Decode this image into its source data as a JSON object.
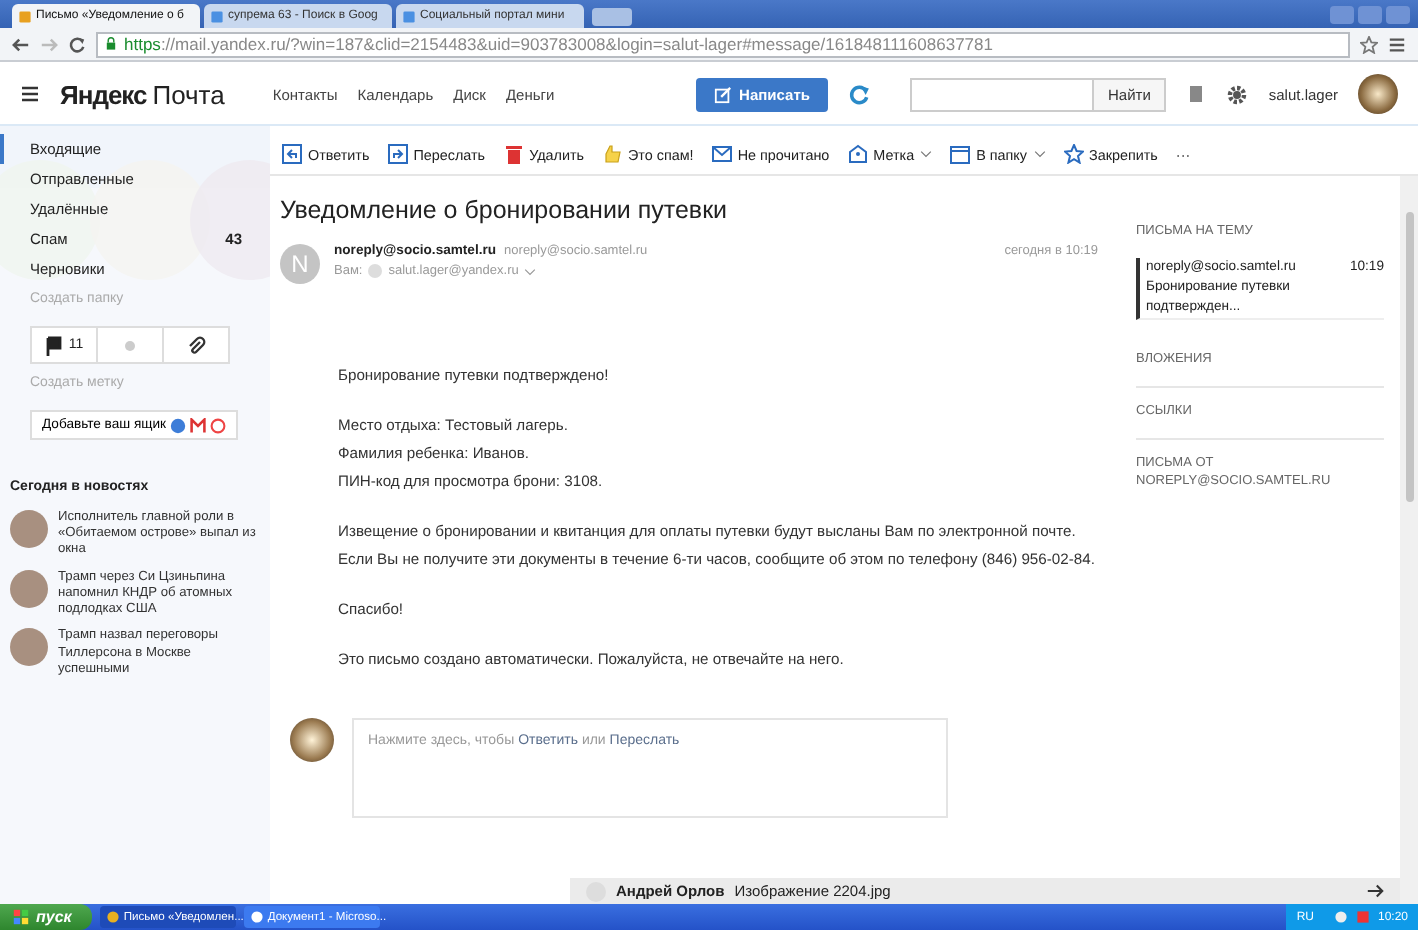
{
  "browser": {
    "tabs": [
      {
        "title": "Письмо «Уведомление о б",
        "selected": true
      },
      {
        "title": "супрема 63 - Поиск в Goog",
        "selected": false
      },
      {
        "title": "Социальный портал мини",
        "selected": false
      }
    ],
    "url_scheme": "https",
    "url_rest": "://mail.yandex.ru/?win=187&clid=2154483&uid=903783008&login=salut-lager#message/161848111608637781"
  },
  "header": {
    "logo_brand": "Яндекс",
    "logo_product": "Почта",
    "nav": [
      "Контакты",
      "Календарь",
      "Диск",
      "Деньги"
    ],
    "compose_button": "Написать",
    "search_button": "Найти",
    "username": "salut.lager"
  },
  "sidebar": {
    "folders": [
      {
        "name": "Входящие",
        "selected": true
      },
      {
        "name": "Отправленные",
        "selected": false
      },
      {
        "name": "Удалённые",
        "selected": false
      },
      {
        "name": "Спам",
        "count": "43",
        "selected": false
      },
      {
        "name": "Черновики",
        "selected": false
      }
    ],
    "create_folder": "Создать папку",
    "filters": [
      {
        "kind": "flag",
        "count": "11"
      },
      {
        "kind": "dot"
      },
      {
        "kind": "clip"
      }
    ],
    "create_label": "Создать метку",
    "add_mailbox": "Добавьте ваш ящик",
    "news_title": "Сегодня в новостях",
    "news": [
      {
        "text": "Исполнитель главной роли в «Обитаемом острове» выпал из окна"
      },
      {
        "text": "Трамп через Си Цзиньпина напомнил КНДР об атомных подлодках США"
      },
      {
        "text": "Трамп назвал переговоры Тиллерсона в Москве успешными"
      }
    ]
  },
  "toolbar": [
    {
      "kind": "reply",
      "label": "Ответить"
    },
    {
      "kind": "forward",
      "label": "Переслать"
    },
    {
      "kind": "delete",
      "label": "Удалить"
    },
    {
      "kind": "spam",
      "label": "Это спам!"
    },
    {
      "kind": "unread",
      "label": "Не прочитано"
    },
    {
      "kind": "label",
      "label": "Метка",
      "dropdown": true
    },
    {
      "kind": "folder",
      "label": "В папку",
      "dropdown": true
    },
    {
      "kind": "pin",
      "label": "Закрепить"
    },
    {
      "kind": "more",
      "label": "···"
    }
  ],
  "message": {
    "subject": "Уведомление о бронировании путевки",
    "avatar_letter": "N",
    "sender_name": "noreply@socio.samtel.ru",
    "sender_email": "noreply@socio.samtel.ru",
    "date": "сегодня в 10:19",
    "to_label": "Вам:",
    "to_email": "salut.lager@yandex.ru",
    "body": [
      [
        "Бронирование путевки подтверждено!"
      ],
      [
        "Место отдыха: Тестовый лагерь.",
        "Фамилия ребенка: Иванов.",
        "ПИН-код для просмотра брони: 3108."
      ],
      [
        "Извещение о бронировании и квитанция для оплаты путевки будут высланы Вам по электронной почте.",
        "Если Вы не получите эти документы в течение 6-ти часов, сообщите об этом по телефону (846) 956-02-84."
      ],
      [
        "Спасибо!"
      ],
      [
        "Это письмо создано автоматически. Пожалуйста, не отвечайте на него."
      ]
    ]
  },
  "reply_box": {
    "text_before": "Нажмите здесь, чтобы",
    "reply_link": "Ответить",
    "text_middle": "или",
    "forward_link": "Переслать"
  },
  "right_panel": {
    "thread_title": "ПИСЬМА НА ТЕМУ",
    "thread": [
      {
        "sender": "noreply@socio.samtel.ru",
        "time": "10:19",
        "snippet": "Бронирование путевки подтвержден..."
      }
    ],
    "sections": [
      "ВЛОЖЕНИЯ",
      "ССЫЛКИ",
      "ПИСЬМА ОТ NOREPLY@SOCIO.SAMTEL.RU"
    ]
  },
  "attachment_bar": {
    "name": "Андрей Орлов",
    "file": "Изображение 2204.jpg"
  },
  "taskbar": {
    "start": "пуск",
    "items": [
      {
        "title": "Письмо «Уведомлен...",
        "selected": true
      },
      {
        "title": "Документ1 - Microso...",
        "selected": false
      }
    ],
    "lang": "RU",
    "time": "10:20"
  }
}
